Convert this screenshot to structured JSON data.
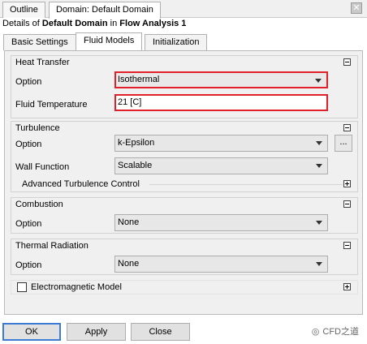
{
  "top_tabs": [
    "Outline",
    "Domain: Default Domain"
  ],
  "details": {
    "prefix": "Details of ",
    "object": "Default Domain",
    "middle": " in ",
    "analysis": "Flow Analysis 1"
  },
  "sub_tabs": [
    "Basic Settings",
    "Fluid Models",
    "Initialization"
  ],
  "heat_transfer": {
    "title": "Heat Transfer",
    "option_label": "Option",
    "option_value": "Isothermal",
    "temp_label": "Fluid Temperature",
    "temp_value": "21 [C]"
  },
  "turbulence": {
    "title": "Turbulence",
    "option_label": "Option",
    "option_value": "k-Epsilon",
    "more_button": "...",
    "wall_label": "Wall Function",
    "wall_value": "Scalable",
    "advanced_label": "Advanced Turbulence Control"
  },
  "combustion": {
    "title": "Combustion",
    "option_label": "Option",
    "option_value": "None"
  },
  "thermal_radiation": {
    "title": "Thermal Radiation",
    "option_label": "Option",
    "option_value": "None"
  },
  "electromagnetic": {
    "label": "Electromagnetic Model"
  },
  "buttons": {
    "ok": "OK",
    "apply": "Apply",
    "close": "Close"
  },
  "watermark": "CFD之道",
  "colors": {
    "highlight": "#e0202a",
    "default_button_border": "#3d7bd4"
  }
}
